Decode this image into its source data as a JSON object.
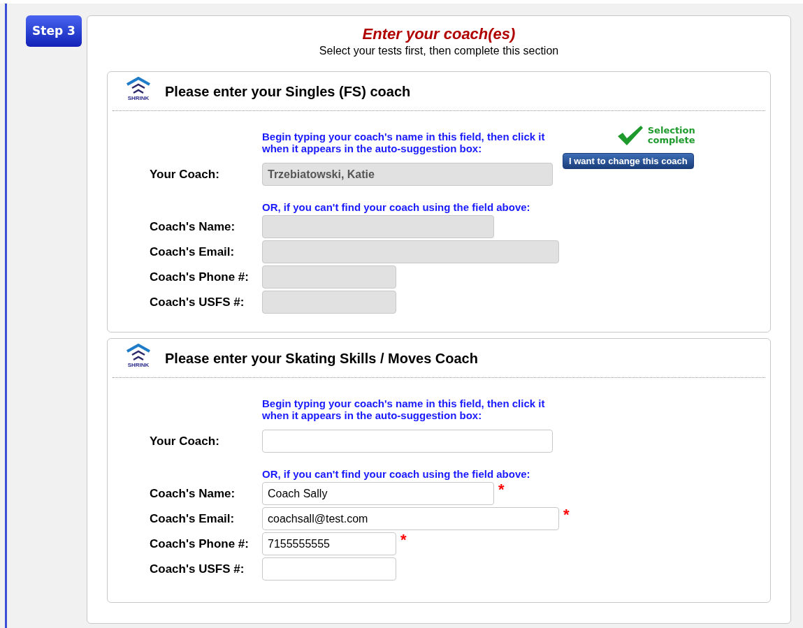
{
  "step": {
    "label": "Step 3"
  },
  "header": {
    "title": "Enter your coach(es)",
    "subtitle": "Select your tests first, then complete this section"
  },
  "sections": [
    {
      "title": "Please enter your Singles (FS) coach",
      "shrink_label": "SHRINK",
      "hint": "Begin typing your coach's name in this field, then click it when it appears in the auto-suggestion box:",
      "coach": {
        "label": "Your Coach:",
        "value": "Trzebiatowski, Katie",
        "disabled": true
      },
      "selection": {
        "status": "Selection complete",
        "button": "I want to change this coach"
      },
      "or_hint": "OR, if you can't find your coach using the field above:",
      "fields": [
        {
          "kind": "name",
          "label": "Coach's Name:",
          "disabled": true
        },
        {
          "kind": "email",
          "label": "Coach's Email:",
          "disabled": true
        },
        {
          "kind": "phone",
          "label": "Coach's Phone #:",
          "disabled": true
        },
        {
          "kind": "usfs",
          "label": "Coach's USFS #:",
          "disabled": true
        }
      ]
    },
    {
      "title": "Please enter your Skating Skills / Moves Coach",
      "shrink_label": "SHRINK",
      "hint": "Begin typing your coach's name in this field, then click it when it appears in the auto-suggestion box:",
      "coach": {
        "label": "Your Coach:",
        "disabled": false
      },
      "or_hint": "OR, if you can't find your coach using the field above:",
      "fields": [
        {
          "kind": "name",
          "label": "Coach's Name:",
          "value": "Coach Sally",
          "disabled": false,
          "required_mark": "*"
        },
        {
          "kind": "email",
          "label": "Coach's Email:",
          "value": "coachsall@test.com",
          "disabled": false,
          "required_mark": "*"
        },
        {
          "kind": "phone",
          "label": "Coach's Phone #:",
          "value": "7155555555",
          "disabled": false,
          "required_mark": "*"
        },
        {
          "kind": "usfs",
          "label": "Coach's USFS #:",
          "disabled": false
        }
      ]
    }
  ]
}
